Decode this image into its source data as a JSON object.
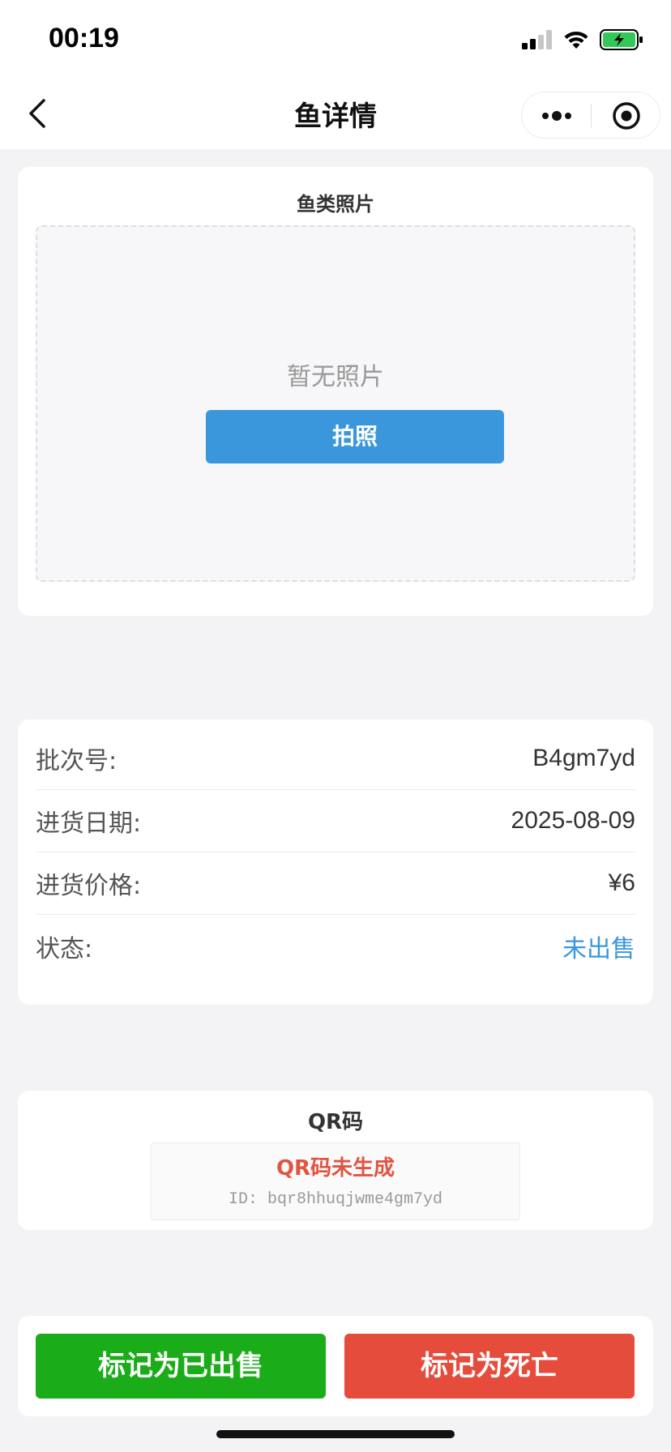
{
  "status_bar": {
    "time": "00:19"
  },
  "nav": {
    "title": "鱼详情"
  },
  "photo_section": {
    "title": "鱼类照片",
    "empty_text": "暂无照片",
    "take_photo_label": "拍照"
  },
  "info": {
    "rows": [
      {
        "label": "批次号:",
        "value": "B4gm7yd"
      },
      {
        "label": "进货日期:",
        "value": "2025-08-09"
      },
      {
        "label": "进货价格:",
        "value": "¥6"
      },
      {
        "label": "状态:",
        "value": "未出售"
      }
    ]
  },
  "qr_section": {
    "title": "QR码",
    "status": "QR码未生成",
    "id_text": "ID: bqr8hhuqjwme4gm7yd"
  },
  "actions": {
    "mark_sold": "标记为已出售",
    "mark_dead": "标记为死亡"
  },
  "colors": {
    "primary_blue": "#3b97db",
    "success_green": "#1aad19",
    "danger_red": "#e64c3c"
  }
}
